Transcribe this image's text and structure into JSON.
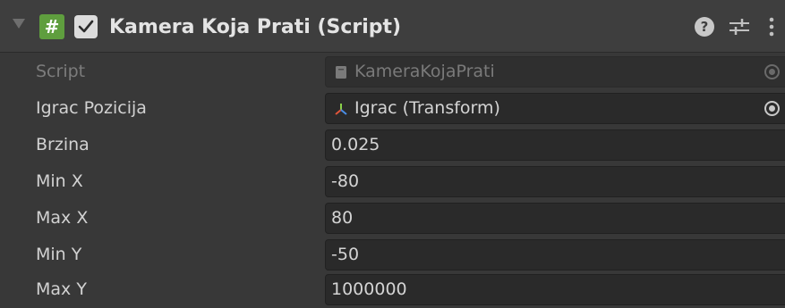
{
  "component": {
    "title": "Kamera Koja Prati (Script)",
    "enabled": true,
    "icons": {
      "foldout": "foldout-arrow-icon",
      "script": "cs-script-icon",
      "help": "help-icon",
      "presets": "presets-sliders-icon",
      "menu": "kebab-menu-icon"
    },
    "script_glyph": "#",
    "help_glyph": "?"
  },
  "properties": [
    {
      "label": "Script",
      "value": "KameraKojaPrati",
      "kind": "object",
      "icon": "script-asset-icon",
      "disabled": true
    },
    {
      "label": "Igrac Pozicija",
      "value": "Igrac (Transform)",
      "kind": "object",
      "icon": "transform-icon",
      "disabled": false
    },
    {
      "label": "Brzina",
      "value": "0.025",
      "kind": "float",
      "disabled": false
    },
    {
      "label": "Min X",
      "value": "-80",
      "kind": "float",
      "disabled": false
    },
    {
      "label": "Max X",
      "value": "80",
      "kind": "float",
      "disabled": false
    },
    {
      "label": "Min Y",
      "value": "-50",
      "kind": "float",
      "disabled": false
    },
    {
      "label": "Max Y",
      "value": "1000000",
      "kind": "float",
      "disabled": false
    }
  ],
  "colors": {
    "background": "#383838",
    "header": "#3e3e3e",
    "field": "#2a2a2a",
    "script_icon": "#5f9e3e"
  }
}
